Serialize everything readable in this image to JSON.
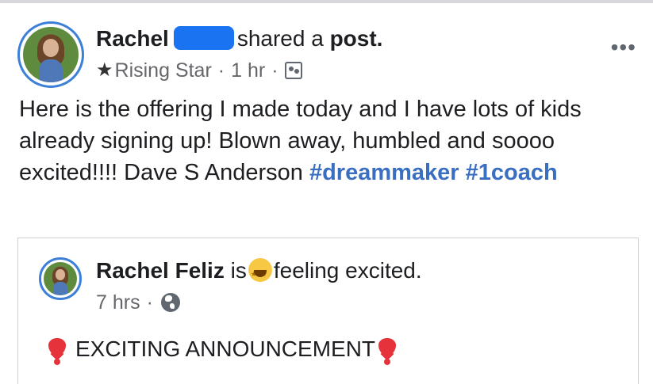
{
  "post": {
    "author_name": "Rachel",
    "action_text": "shared a",
    "action_object": "post.",
    "badge_label": "Rising Star",
    "timestamp": "1 hr",
    "separator": "·",
    "audience_icon": "group-icon",
    "more_icon": "•••",
    "body_text": "Here is the offering I made today and I have lots of kids already signing up! Blown away, humbled and soooo excited!!!! Dave S Anderson ",
    "hashtags": [
      "#dreammaker",
      "#1coach"
    ]
  },
  "shared_post": {
    "author_name": "Rachel Feliz",
    "connector": "is",
    "feeling_text": "feeling excited.",
    "timestamp": "7 hrs",
    "separator": "·",
    "audience_icon": "globe-icon",
    "announcement": "EXCITING ANNOUNCEMENT"
  },
  "colors": {
    "hashtag": "#3a6ec0",
    "avatar_ring": "#3b7fd9",
    "redaction": "#1a73f0",
    "meta_gray": "#65676b"
  }
}
